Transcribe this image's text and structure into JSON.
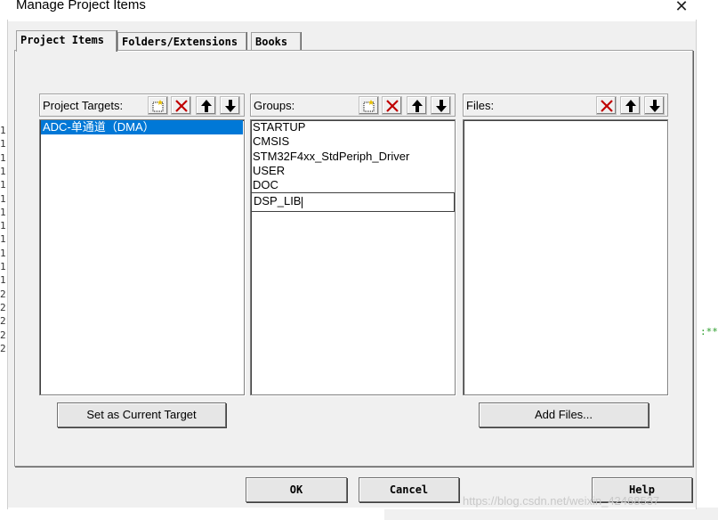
{
  "dialog": {
    "title": "Manage Project Items",
    "close_symbol": "✕"
  },
  "tabs": [
    {
      "label": "Project Items",
      "active": true
    },
    {
      "label": "Folders/Extensions",
      "active": false
    },
    {
      "label": "Books",
      "active": false
    }
  ],
  "targets": {
    "label": "Project Targets:",
    "items": [
      "ADC-单通道（DMA）"
    ],
    "selected_index": 0,
    "set_current_label": "Set as Current Target"
  },
  "groups": {
    "label": "Groups:",
    "items": [
      "STARTUP",
      "CMSIS",
      "STM32F4xx_StdPeriph_Driver",
      "USER",
      "DOC"
    ],
    "editing_value": "DSP_LIB"
  },
  "files": {
    "label": "Files:",
    "items": [],
    "add_label": "Add Files..."
  },
  "footer": {
    "ok_label": "OK",
    "cancel_label": "Cancel",
    "help_label": "Help"
  },
  "background": {
    "gutter_digits": [
      "1",
      "1",
      "1",
      "1",
      "1",
      "1",
      "1",
      "1",
      "1",
      "1",
      "1",
      "1",
      "2",
      "2",
      "2",
      "2",
      "2"
    ],
    "code_fragment": ":**"
  },
  "watermark": "https://blog.csdn.net/weixin_42468537",
  "colors": {
    "selection": "#0078d7",
    "dialog_face": "#f0f0f0",
    "delete_icon": "#c00000"
  }
}
